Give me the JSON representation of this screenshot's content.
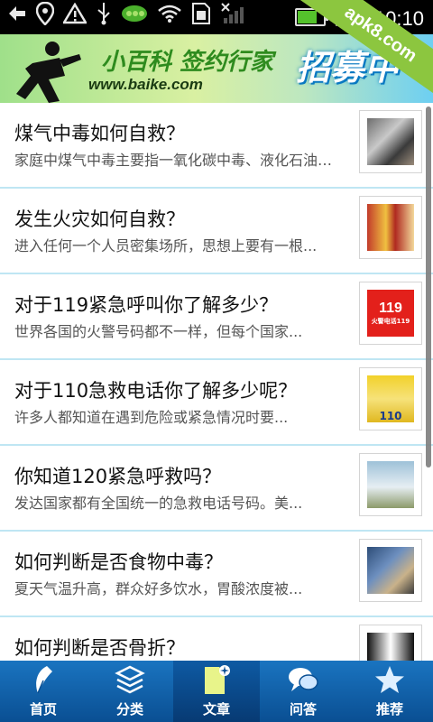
{
  "status_bar": {
    "time": "上午10:10",
    "icons": [
      "back-icon",
      "location-icon",
      "warning-icon",
      "usb-icon",
      "pea-icon",
      "wifi-icon",
      "sim-icon",
      "signal-icon",
      "battery-icon"
    ]
  },
  "watermark": "apk8.com",
  "banner": {
    "title": "小百科 签约行家",
    "url": "www.baike.com",
    "recruit": "招募中"
  },
  "articles": [
    {
      "title": "煤气中毒如何自救？",
      "summary": "家庭中煤气中毒主要指一氧化碳中毒、液化石油气..."
    },
    {
      "title": "发生火灾如何自救？",
      "summary": "进入任何一个人员密集场所，思想上要有一根..."
    },
    {
      "title": "对于119紧急呼叫你了解多少？",
      "summary": "世界各国的火警号码都不一样，但每个国家..."
    },
    {
      "title": "对于110急救电话你了解多少呢？",
      "summary": "  许多人都知道在遇到危险或紧急情况时要..."
    },
    {
      "title": "你知道120紧急呼救吗？",
      "summary": "发达国家都有全国统一的急救电话号码。美..."
    },
    {
      "title": "如何判断是否食物中毒？",
      "summary": "夏天气温升高，群众好多饮水，胃酸浓度被..."
    },
    {
      "title": "如何判断是否骨折？",
      "summary": ""
    }
  ],
  "thumbs": {
    "t3_number": "119",
    "t3_caption": "火警电话119",
    "t4_number": "110"
  },
  "nav": [
    {
      "label": "首页"
    },
    {
      "label": "分类"
    },
    {
      "label": "文章"
    },
    {
      "label": "问答"
    },
    {
      "label": "推荐"
    }
  ],
  "colors": {
    "nav_bg": "#0a4f93",
    "divider": "#bfe6f3",
    "ribbon": "#8cc63f"
  }
}
